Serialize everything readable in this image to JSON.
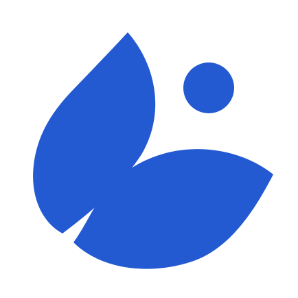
{
  "logo": {
    "icon_name": "abstract-leaves-and-dot-logo-icon",
    "colors": {
      "background": "#ffffff",
      "primary": "#2359D1"
    }
  }
}
